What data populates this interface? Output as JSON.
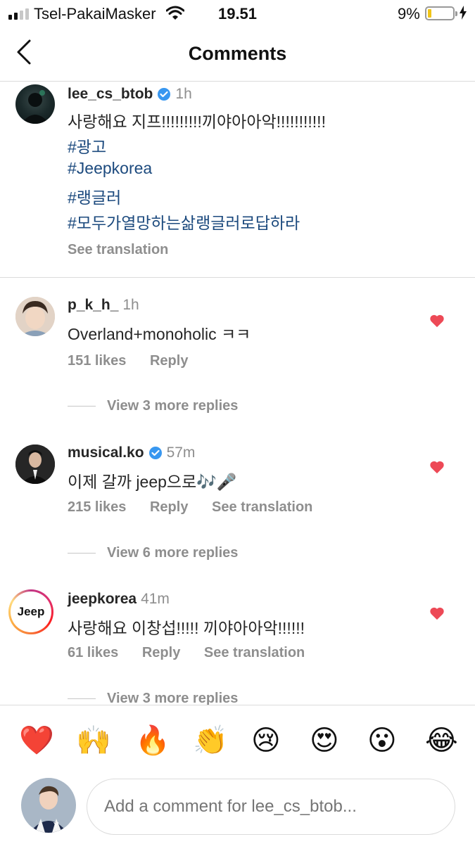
{
  "status_bar": {
    "carrier": "Tsel-PakaiMasker",
    "time": "19.51",
    "battery": "9%",
    "battery_level": 0.09,
    "icons": [
      "signal-icon",
      "wifi-icon",
      "battery-icon",
      "charging-icon"
    ]
  },
  "header": {
    "title": "Comments",
    "back_icon": "chevron-left-icon"
  },
  "caption": {
    "username": "lee_cs_btob",
    "verified": true,
    "time": "1h",
    "text": "사랑해요 지프!!!!!!!!!끼야아아악!!!!!!!!!!!",
    "hashtags": [
      "#광고",
      "#Jeepkorea",
      "#랭글러",
      "#모두가열망하는삶랭글러로답하라"
    ],
    "see_translation": "See translation"
  },
  "comments": [
    {
      "username": "p_k_h_",
      "verified": false,
      "time": "1h",
      "text": "Overland+monoholic ㅋㅋ",
      "likes": "151 likes",
      "reply": "Reply",
      "see_translation": "",
      "view_replies": "View 3 more replies",
      "liked": true
    },
    {
      "username": "musical.ko",
      "verified": true,
      "time": "57m",
      "text": "이제 갈까 jeep으로🎶🎤",
      "likes": "215 likes",
      "reply": "Reply",
      "see_translation": "See translation",
      "view_replies": "View 6 more replies",
      "liked": true
    },
    {
      "username": "jeepkorea",
      "verified": false,
      "time": "41m",
      "text": "사랑해요 이창섭!!!!! 끼야아아악!!!!!!",
      "likes": "61 likes",
      "reply": "Reply",
      "see_translation": "See translation",
      "view_replies": "View 3 more replies",
      "liked": true,
      "avatar_text": "Jeep"
    }
  ],
  "emoji_bar": [
    "❤️",
    "🙌",
    "🔥",
    "👏",
    "😢",
    "😍",
    "😮",
    "😂"
  ],
  "composer": {
    "placeholder": "Add a comment for lee_cs_btob..."
  },
  "colors": {
    "hashtag": "#1c4a7e",
    "heart": "#ed4956",
    "verified": "#3897f0",
    "muted": "#8e8e8e"
  }
}
